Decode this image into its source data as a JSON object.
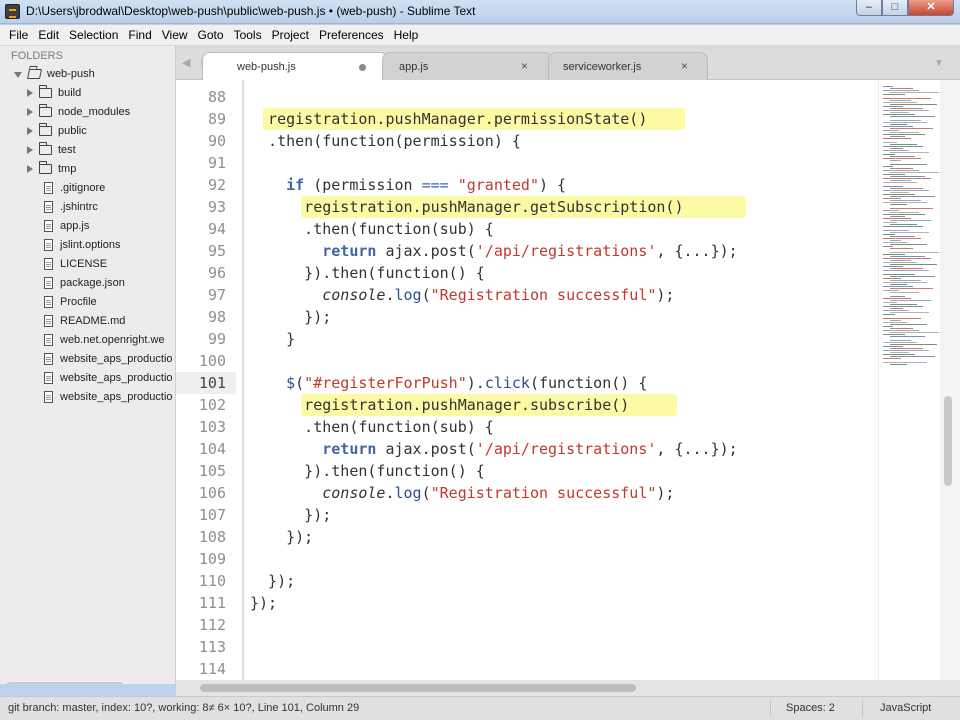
{
  "window": {
    "title": "D:\\Users\\jbrodwal\\Desktop\\web-push\\public\\web-push.js • (web-push) - Sublime Text",
    "minimize": "–",
    "maximize": "□",
    "close": "✕"
  },
  "menu": [
    "File",
    "Edit",
    "Selection",
    "Find",
    "View",
    "Goto",
    "Tools",
    "Project",
    "Preferences",
    "Help"
  ],
  "sidebar": {
    "header": "FOLDERS",
    "root": "web-push",
    "folders": [
      "build",
      "node_modules",
      "public",
      "test",
      "tmp"
    ],
    "files": [
      ".gitignore",
      ".jshintrc",
      "app.js",
      "jslint.options",
      "LICENSE",
      "package.json",
      "Procfile",
      "README.md",
      "web.net.openright.we",
      "website_aps_productio",
      "website_aps_productio",
      "website_aps_productio"
    ]
  },
  "tabs": [
    {
      "label": "web-push.js",
      "active": true,
      "dirty": true
    },
    {
      "label": "app.js",
      "active": false,
      "close": "×"
    },
    {
      "label": "serviceworker.js",
      "active": false,
      "close": "×"
    }
  ],
  "tab_nav": "◀ ▶",
  "tab_menu": "▼",
  "editor": {
    "current_line": "101",
    "lines": [
      {
        "num": "88",
        "text": ""
      },
      {
        "num": "89",
        "text": "  registration.pushManager.permissionState()"
      },
      {
        "num": "90",
        "text": "  .then(function(permission) {"
      },
      {
        "num": "91",
        "text": ""
      },
      {
        "num": "92",
        "text": "    if (permission === \"granted\") {"
      },
      {
        "num": "93",
        "text": "      registration.pushManager.getSubscription()"
      },
      {
        "num": "94",
        "text": "      .then(function(sub) {"
      },
      {
        "num": "95",
        "text": "        return ajax.post('/api/registrations', {...});"
      },
      {
        "num": "96",
        "text": "      }).then(function() {"
      },
      {
        "num": "97",
        "text": "        console.log(\"Registration successful\");"
      },
      {
        "num": "98",
        "text": "      });"
      },
      {
        "num": "99",
        "text": "    }"
      },
      {
        "num": "100",
        "text": ""
      },
      {
        "num": "101",
        "text": "    $(\"#registerForPush\").click(function() {"
      },
      {
        "num": "102",
        "text": "      registration.pushManager.subscribe()"
      },
      {
        "num": "103",
        "text": "      .then(function(sub) {"
      },
      {
        "num": "104",
        "text": "        return ajax.post('/api/registrations', {...});"
      },
      {
        "num": "105",
        "text": "      }).then(function() {"
      },
      {
        "num": "106",
        "text": "        console.log(\"Registration successful\");"
      },
      {
        "num": "107",
        "text": "      });"
      },
      {
        "num": "108",
        "text": "    });"
      },
      {
        "num": "109",
        "text": ""
      },
      {
        "num": "110",
        "text": "  });"
      },
      {
        "num": "111",
        "text": "});"
      },
      {
        "num": "112",
        "text": ""
      },
      {
        "num": "113",
        "text": ""
      },
      {
        "num": "114",
        "text": ""
      }
    ]
  },
  "colors": {
    "highlight": "#fcfaa5",
    "keyword": "#4065a7",
    "string": "#c0392b"
  },
  "status": {
    "left": "git branch: master, index: 10?, working: 8≠ 6× 10?, Line 101, Column 29",
    "spaces": "Spaces: 2",
    "syntax": "JavaScript"
  }
}
